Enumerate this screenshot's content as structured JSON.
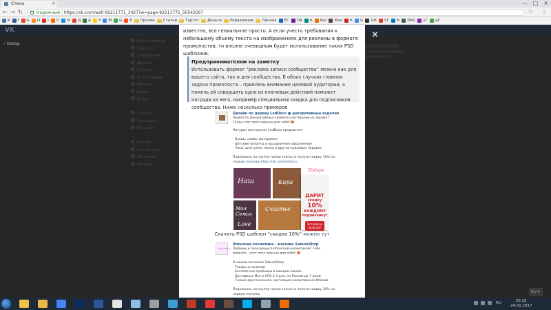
{
  "browser": {
    "tab_title": "Стена",
    "tab_close": "×",
    "window_controls": [
      "—",
      "□",
      "×"
    ],
    "url_secure_label": "Надежный",
    "url": "https://vk.com/wall-92211771_3427?w=page-92211771_50542567",
    "bookmarks": [
      {
        "label": "K",
        "color": "#4a76a8"
      },
      {
        "label": "f",
        "color": "#3b5998"
      },
      {
        "label": "G",
        "color": "#ea4335"
      },
      {
        "label": "O",
        "color": "#f7931e"
      },
      {
        "label": "I",
        "color": "#d93025"
      },
      {
        "label": "O",
        "color": "#ff6600"
      },
      {
        "label": "M",
        "color": "#168de2"
      },
      {
        "label": "Д",
        "color": "#e53935"
      },
      {
        "label": "А",
        "color": "#2e7d32"
      },
      {
        "label": "Y",
        "color": "#ffcc00"
      },
      {
        "label": "M",
        "color": "#4285f4"
      },
      {
        "label": "G",
        "color": "#34a853"
      },
      {
        "label": "Р",
        "color": "#f4511e"
      },
      {
        "label": "Прочее",
        "folder": true
      },
      {
        "label": "Статьи",
        "folder": true
      },
      {
        "label": "Таргет",
        "folder": true
      },
      {
        "label": "Деньги",
        "folder": true
      },
      {
        "label": "Управление",
        "folder": true
      },
      {
        "label": "Личное",
        "folder": true
      },
      {
        "label": "ЕС",
        "color": "#1565c0"
      },
      {
        "label": "ПА",
        "color": "#6a1b9a"
      },
      {
        "label": "К",
        "color": "#00897b"
      },
      {
        "label": "бус",
        "color": "#ef6c00"
      },
      {
        "label": "Фон",
        "color": "#5d4037"
      },
      {
        "label": "К",
        "color": "#c62828"
      },
      {
        "label": "G",
        "color": "#4285f4"
      },
      {
        "label": "GH",
        "color": "#333333"
      },
      {
        "label": "VC",
        "color": "#e53935"
      },
      {
        "label": "К",
        "color": "#0277bd"
      },
      {
        "label": "DML",
        "color": "#455a64"
      },
      {
        "label": "уГ",
        "color": "#8e24aa"
      },
      {
        "label": "уР",
        "color": "#43a047"
      }
    ]
  },
  "vk": {
    "logo": "VK",
    "back_link": "Назад",
    "close_icon": "×",
    "left_menu": [
      "Моя страница",
      "Новости",
      "Сообщения",
      "Друзья",
      "Группы",
      "Фотографии",
      "Музыка",
      "Видео",
      "Игры",
      "",
      "Товары",
      "Закладки",
      "Реклама",
      "",
      "Бизнес",
      "Статистика",
      "Полезное",
      "Помощь"
    ],
    "lang_widget": "RU ▾"
  },
  "article": {
    "intro": "известно, все гениальное просто. А если учесть требования к небольшому объему текста на изображениях для рекламы в формате промопостов, то вполне очевидным будет использование таких PSD шаблонов.",
    "note_title": "Предпринимателям на заметку",
    "note_body": "Использовать формат “реклама записи сообщества” можно как для вашего сайта, так и для сообщества. В обоих случаях главная задача промопоста – привлечь внимание целевой аудитории, а помочь ей совершить одно из ключевых действий поможет награда за него, например специальная скидка для подписчиков сообщества. Ниже несколько примеров",
    "post1": {
      "name": "Дизайн по дереву LedDeco ● декоративные изделия",
      "text": "Нравятся декоративные элементы интерьера из дерева? Тогда этот пост именно для тебя!",
      "lines": [
        "Натуран мастерская LedDeco предлагает:",
        "",
        "- Буквы, слова, фоторамки",
        "- Детские потреты и праздничное оформление",
        "- Часы, шкатулки, панно и другие красивые подарки",
        "",
        "Подпишись на группу прямо сейчас и получи скидку 10% на",
        "первую покупку  https://vk.com/leddeco"
      ]
    },
    "promo": {
      "tile1": "Наш",
      "tile2": "Кира",
      "tile3": "Моя Семья",
      "tile4": "Счастье",
      "tile5": "Love",
      "corner": "Подари",
      "badge_l1": "ДАРИТ",
      "badge_l2": "скидку",
      "badge_l3": "10%",
      "badge_l4": "КАЖДОМУ подписчику!",
      "badge_btn": "Вступай и покупай!"
    },
    "download_text": "Скачать PSD шаблон “скидка 10%”",
    "download_link": "можно тут",
    "post2": {
      "name": "Японская косметика – магазин SakuraShop",
      "avatar_text": "SakuraShop",
      "text": "Любишь и пользуешься японской косметикой? Тебе повезло - этот пост именно для тебя!",
      "lines": [
        "В нашем магазине SakuraShop:",
        "- Товары в наличии",
        "- Бесплатные пробники в каждом заказе",
        "- Доставка в Мск и СПб 2-3 дня, по России до 7 дней",
        "- Только оригинальная, настоящая косметика из Японии",
        "",
        "Подпишись на группу прямо сейчас и получи скидку 10%  на",
        "первую покупку"
      ]
    }
  },
  "taskbar": {
    "apps": [
      {
        "name": "explorer-icon",
        "color": "#f0c24b"
      },
      {
        "name": "folder-icon",
        "color": "#e8b94a"
      },
      {
        "name": "chrome-icon",
        "color": "#4285f4"
      },
      {
        "name": "photoshop-icon",
        "color": "#0c2d5c"
      },
      {
        "name": "word-icon",
        "color": "#2b579a"
      },
      {
        "name": "notepad-icon",
        "color": "#e5e5e5"
      },
      {
        "name": "paint-icon",
        "color": "#8fbfe3"
      },
      {
        "name": "tool-icon",
        "color": "#9e9e9e"
      },
      {
        "name": "mail-icon",
        "color": "#3f9ad8"
      },
      {
        "name": "pen-icon",
        "color": "#c23b22"
      },
      {
        "name": "pdf-icon",
        "color": "#e53935"
      },
      {
        "name": "archive-icon",
        "color": "#6d4c41"
      },
      {
        "name": "skype-icon",
        "color": "#00aff0"
      },
      {
        "name": "plane-icon",
        "color": "#90a4ae"
      },
      {
        "name": "calculator-icon",
        "color": "#ef6c00"
      }
    ],
    "lang": "RU",
    "time": "20:25",
    "date": "24.01.2017"
  }
}
